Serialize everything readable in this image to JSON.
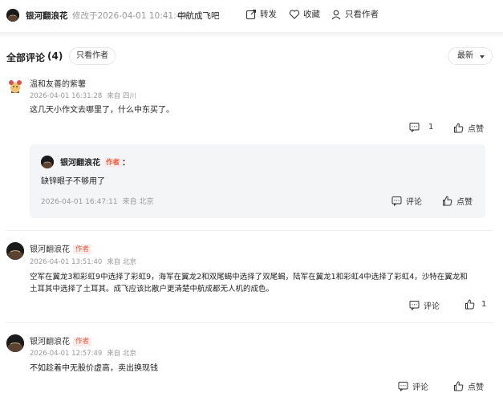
{
  "top": {
    "author": "银河翻浪花",
    "modified": "修改于2026-04-01 10:41:49",
    "forum": "中航成飞吧",
    "share_label": "转发",
    "favorite_label": "收藏",
    "author_only_label": "只看作者"
  },
  "comments_header": {
    "title": "全部评论",
    "count": "(4)",
    "author_only_label": "只看作者",
    "sort_label": "最新"
  },
  "comments": [
    {
      "username": "温和友善的紫薯",
      "time": "2026-04-01 16:31:28",
      "location": "来自 四川",
      "text": "这几天小作文去哪里了，什么中东买了。",
      "reply_count": "1",
      "like_label": "点赞",
      "reply": {
        "username": "银河翻浪花",
        "author_tag": "作者",
        "colon": "：",
        "text": "缺锌眼子不够用了",
        "time": "2026-04-01 16:47:11",
        "location": "来自 北京",
        "comment_label": "评论",
        "like_label": "点赞"
      }
    },
    {
      "username": "银河翻浪花",
      "author_tag": "作者",
      "time": "2026-04-01 13:51:40",
      "location": "来自 北京",
      "text_line1": "空军在翼龙3和彩虹9中选择了彩虹9，海军在翼龙2和双尾蝎中选择了双尾蝎，陆军在翼龙1和彩虹4中选择了彩虹4，沙特在翼龙和",
      "text_line2": "土耳其中选择了土耳其。成飞应该比散户更清楚中航成都无人机的成色。",
      "comment_label": "评论",
      "like_count": "1"
    },
    {
      "username": "银河翻浪花",
      "author_tag": "作者",
      "time": "2026-04-01 12:57:49",
      "location": "来自 北京",
      "text": "不如趁着中无股价虚高，卖出换现钱",
      "comment_label": "评论",
      "like_label": "点赞"
    }
  ],
  "icons": [
    "share-icon",
    "heart-icon",
    "person-icon",
    "comment-icon",
    "thumb-up-icon",
    "chevron-down-icon"
  ]
}
